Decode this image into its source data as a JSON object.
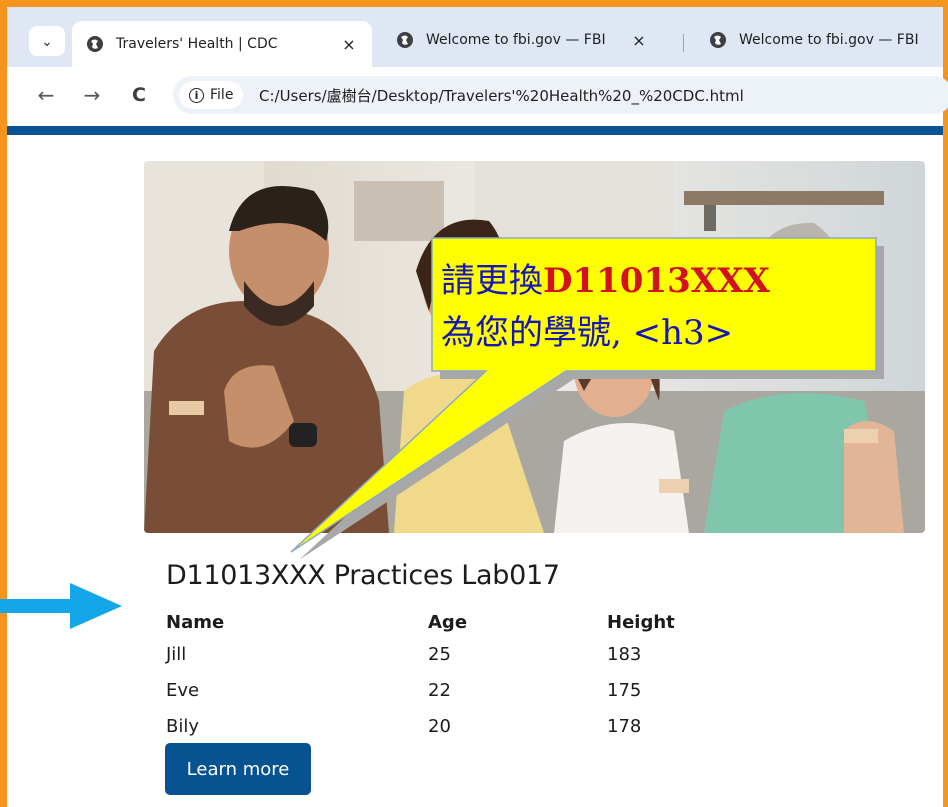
{
  "browser": {
    "tabs": [
      {
        "title": "Travelers' Health | CDC",
        "close": "×"
      },
      {
        "title": "Welcome to fbi.gov — FBI",
        "close": "×"
      },
      {
        "title": "Welcome to fbi.gov — FBI"
      }
    ],
    "nav": {
      "back": "←",
      "forward": "→",
      "reload": "C",
      "tab_menu": "⌄"
    },
    "address": {
      "chip_icon": "i",
      "chip_label": "File",
      "url": "C:/Users/盧樹台/Desktop/Travelers'%20Health%20_%20CDC.html"
    }
  },
  "page": {
    "heading": "D11013XXX Practices Lab017",
    "table": {
      "headers": [
        "Name",
        "Age",
        "Height"
      ],
      "rows": [
        [
          "Jill",
          "25",
          "183"
        ],
        [
          "Eve",
          "22",
          "175"
        ],
        [
          "Bily",
          "20",
          "178"
        ]
      ]
    },
    "button": "Learn more"
  },
  "annotation": {
    "line1_prefix": "請更換",
    "line1_highlight": "D11013XXX",
    "line2": "為您的學號, <h3>"
  },
  "colors": {
    "frame": "#f7941d",
    "brand_blue": "#075290",
    "arrow": "#13a6e8",
    "callout_fill": "#ffff00"
  },
  "icons": [
    "globe-icon",
    "close-icon",
    "back-arrow-icon",
    "forward-arrow-icon",
    "reload-icon",
    "info-icon",
    "chevron-down-icon",
    "pointer-arrow-icon"
  ]
}
